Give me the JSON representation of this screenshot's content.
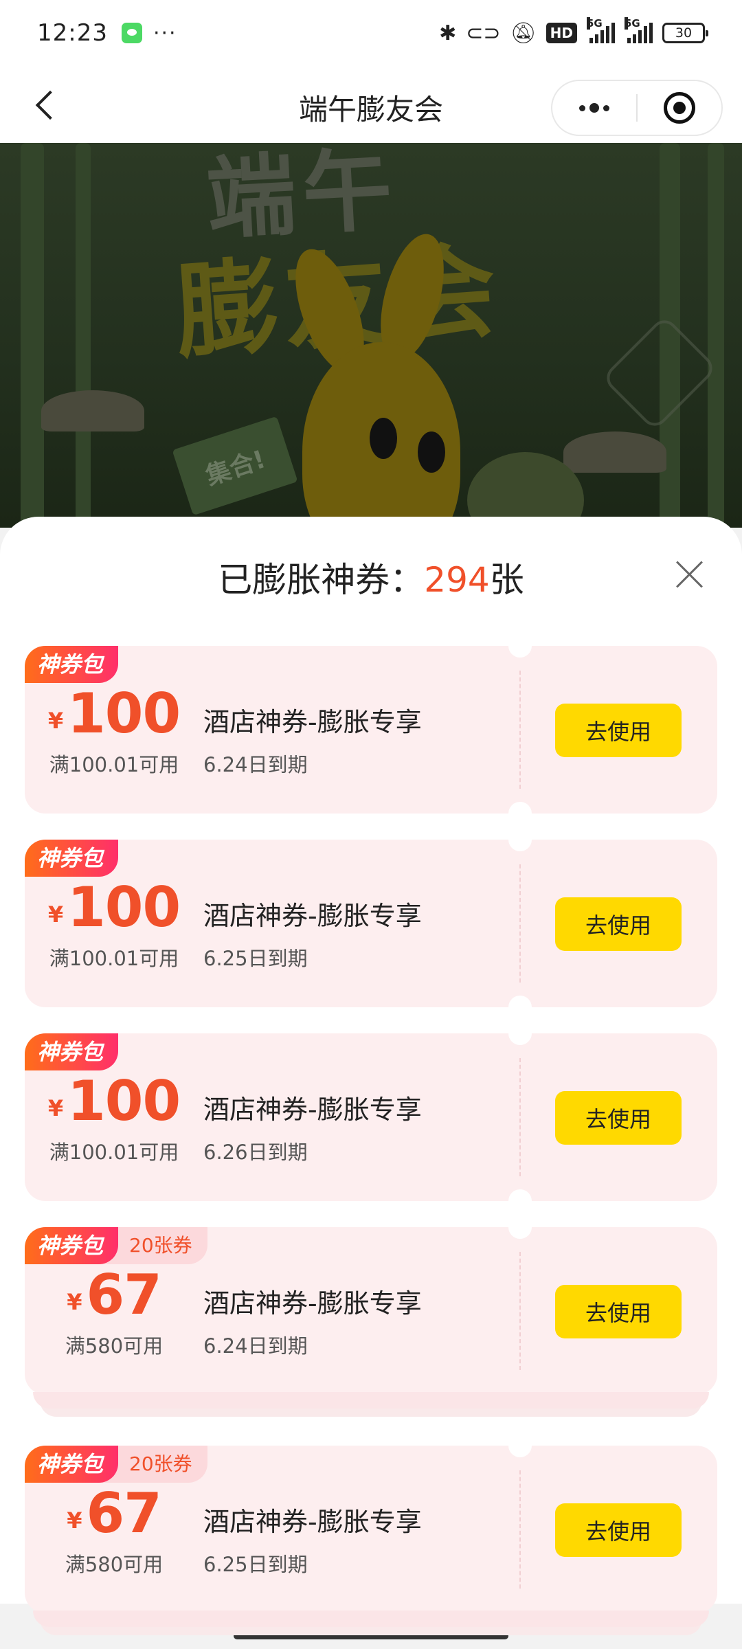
{
  "status_bar": {
    "time": "12:23",
    "more": "···",
    "hd_label": "HD",
    "network_1": "5G",
    "network_2": "5G",
    "battery": "30"
  },
  "nav": {
    "title": "端午膨友会"
  },
  "hero": {
    "title_top": "端午",
    "title_main": "膨友会",
    "flag_text": "集合!"
  },
  "sheet": {
    "title_prefix": "已膨胀神券：",
    "count": "294",
    "title_suffix": "张"
  },
  "coupons": [
    {
      "tag": "神券包",
      "currency": "¥",
      "amount": "100",
      "condition": "满100.01可用",
      "name": "酒店神券-膨胀专享",
      "expiry": "6.24日到期",
      "button": "去使用"
    },
    {
      "tag": "神券包",
      "currency": "¥",
      "amount": "100",
      "condition": "满100.01可用",
      "name": "酒店神券-膨胀专享",
      "expiry": "6.25日到期",
      "button": "去使用"
    },
    {
      "tag": "神券包",
      "currency": "¥",
      "amount": "100",
      "condition": "满100.01可用",
      "name": "酒店神券-膨胀专享",
      "expiry": "6.26日到期",
      "button": "去使用"
    },
    {
      "tag": "神券包",
      "sub_tag": "20张券",
      "currency": "¥",
      "amount": "67",
      "condition": "满580可用",
      "name": "酒店神券-膨胀专享",
      "expiry": "6.24日到期",
      "button": "去使用"
    },
    {
      "tag": "神券包",
      "sub_tag": "20张券",
      "currency": "¥",
      "amount": "67",
      "condition": "满580可用",
      "name": "酒店神券-膨胀专享",
      "expiry": "6.25日到期",
      "button": "去使用"
    }
  ],
  "colors": {
    "accent": "#f0502a",
    "button": "#ffd900",
    "coupon_bg": "#fdeeef"
  }
}
